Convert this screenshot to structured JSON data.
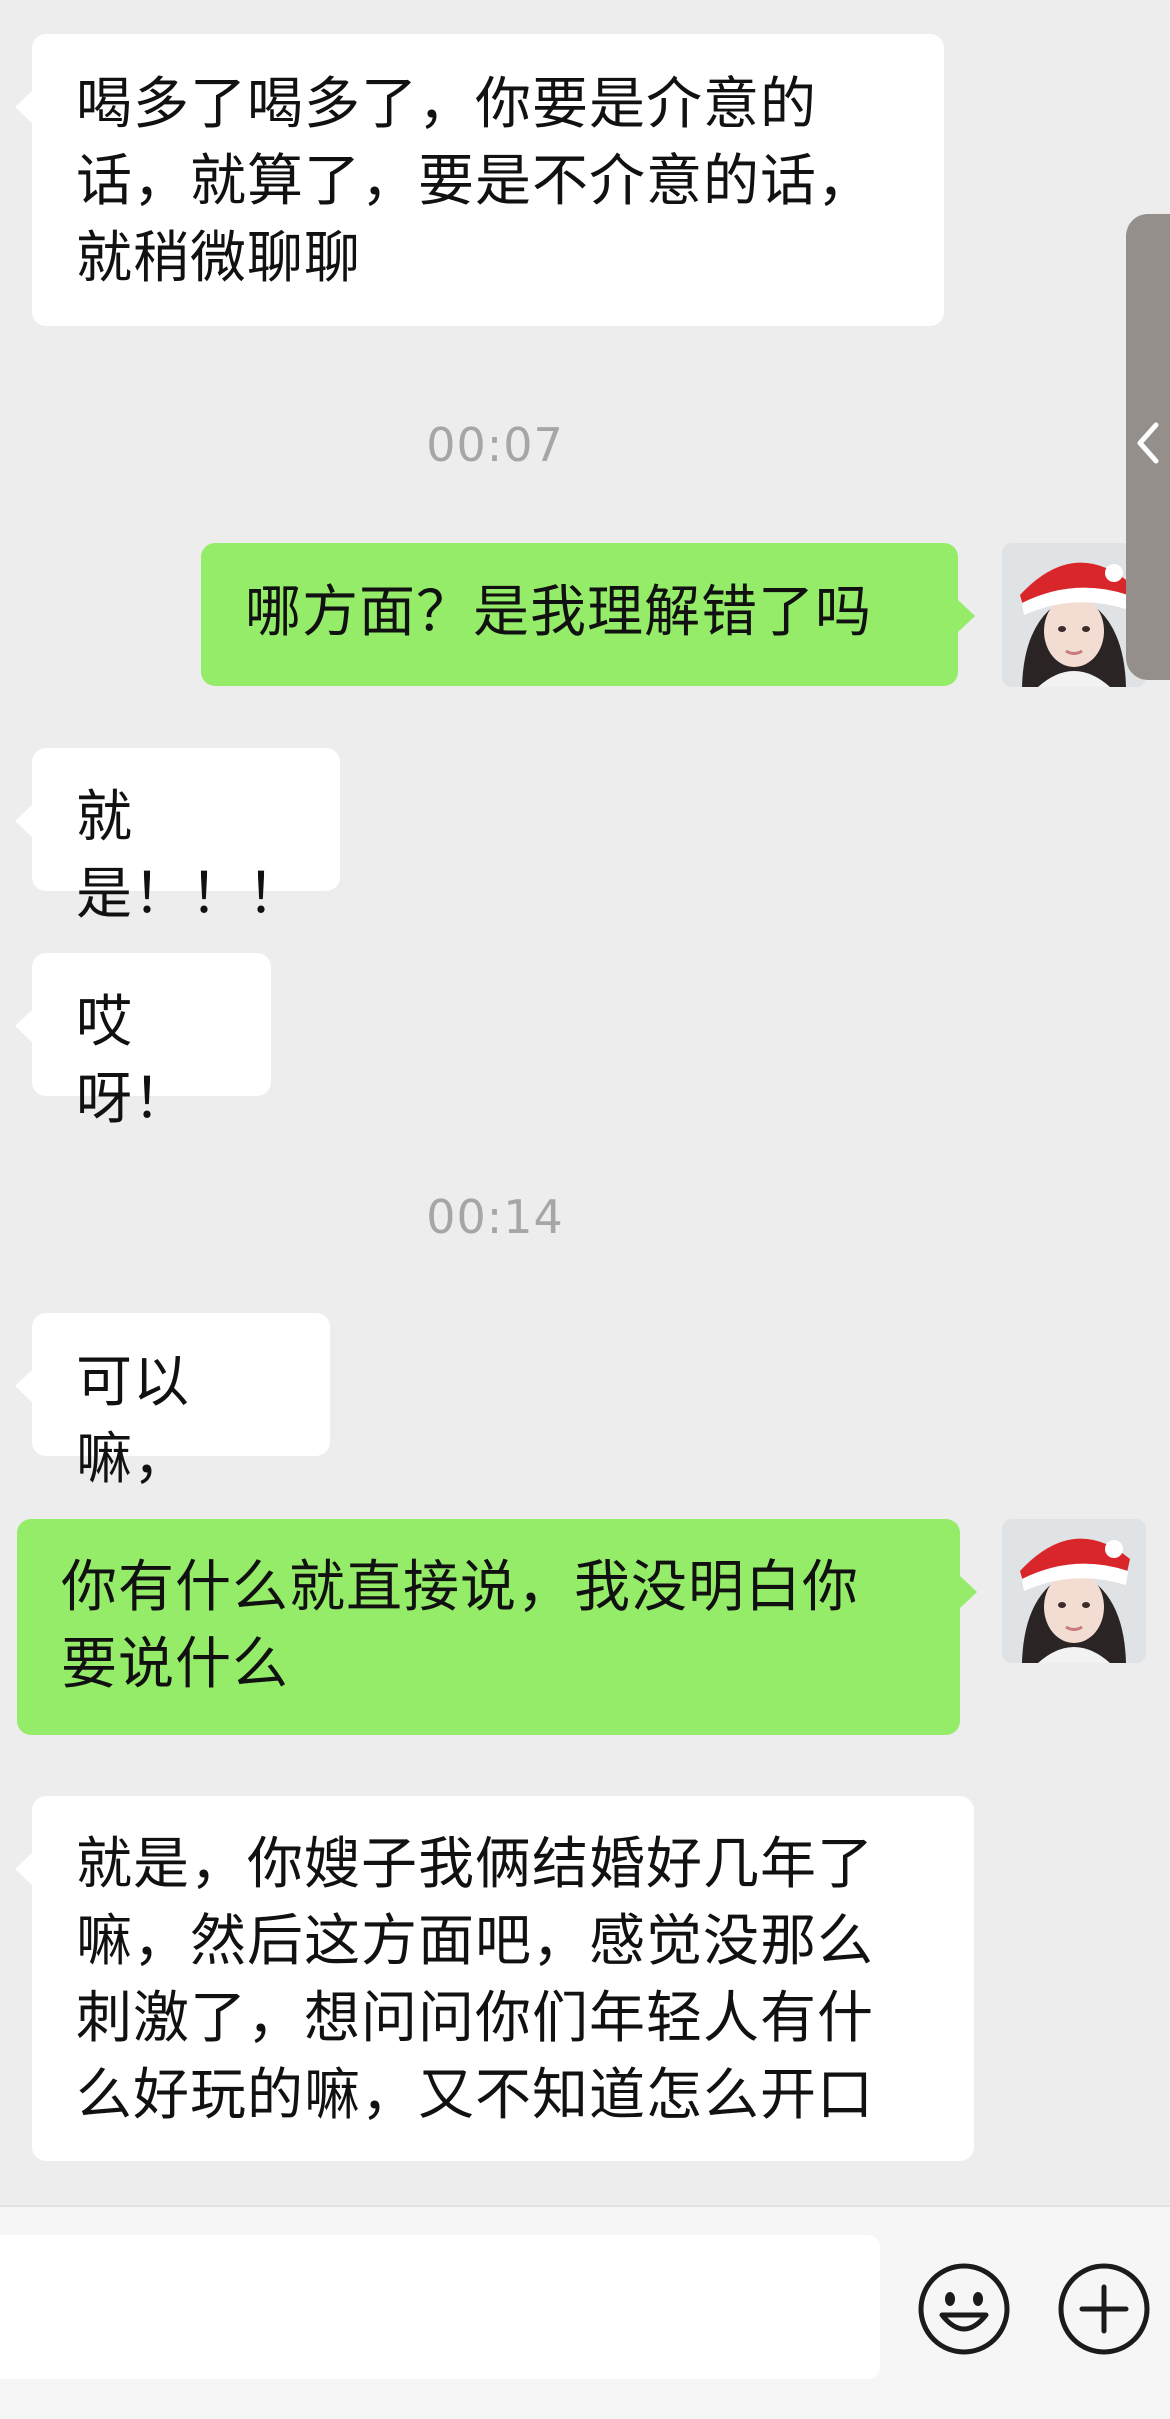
{
  "chat": {
    "messages": [
      {
        "text": "喝多了喝多了，你要是介意的\n话，就算了，要是不介意的话，\n就稍微聊聊"
      },
      {
        "text": "00:07"
      },
      {
        "text": "哪方面？是我理解错了吗"
      },
      {
        "text": "就是！！！"
      },
      {
        "text": "哎呀！"
      },
      {
        "text": "00:14"
      },
      {
        "text": "可以嘛，"
      },
      {
        "text": "你有什么就直接说，我没明白你\n要说什么"
      },
      {
        "text": "就是，你嫂子我俩结婚好几年了\n嘛，然后这方面吧，感觉没那么\n刺激了，想问问你们年轻人有什\n么好玩的嘛，又不知道怎么开口"
      }
    ]
  },
  "colors": {
    "background": "#ededed",
    "incoming_bubble": "#ffffff",
    "outgoing_bubble": "#95ec69",
    "timestamp": "#a6a6a6"
  },
  "icons": {
    "avatar": "avatar-photo",
    "emoji": "smiley-face-icon",
    "plus": "plus-circle-icon",
    "side": "chevron-left-icon"
  }
}
